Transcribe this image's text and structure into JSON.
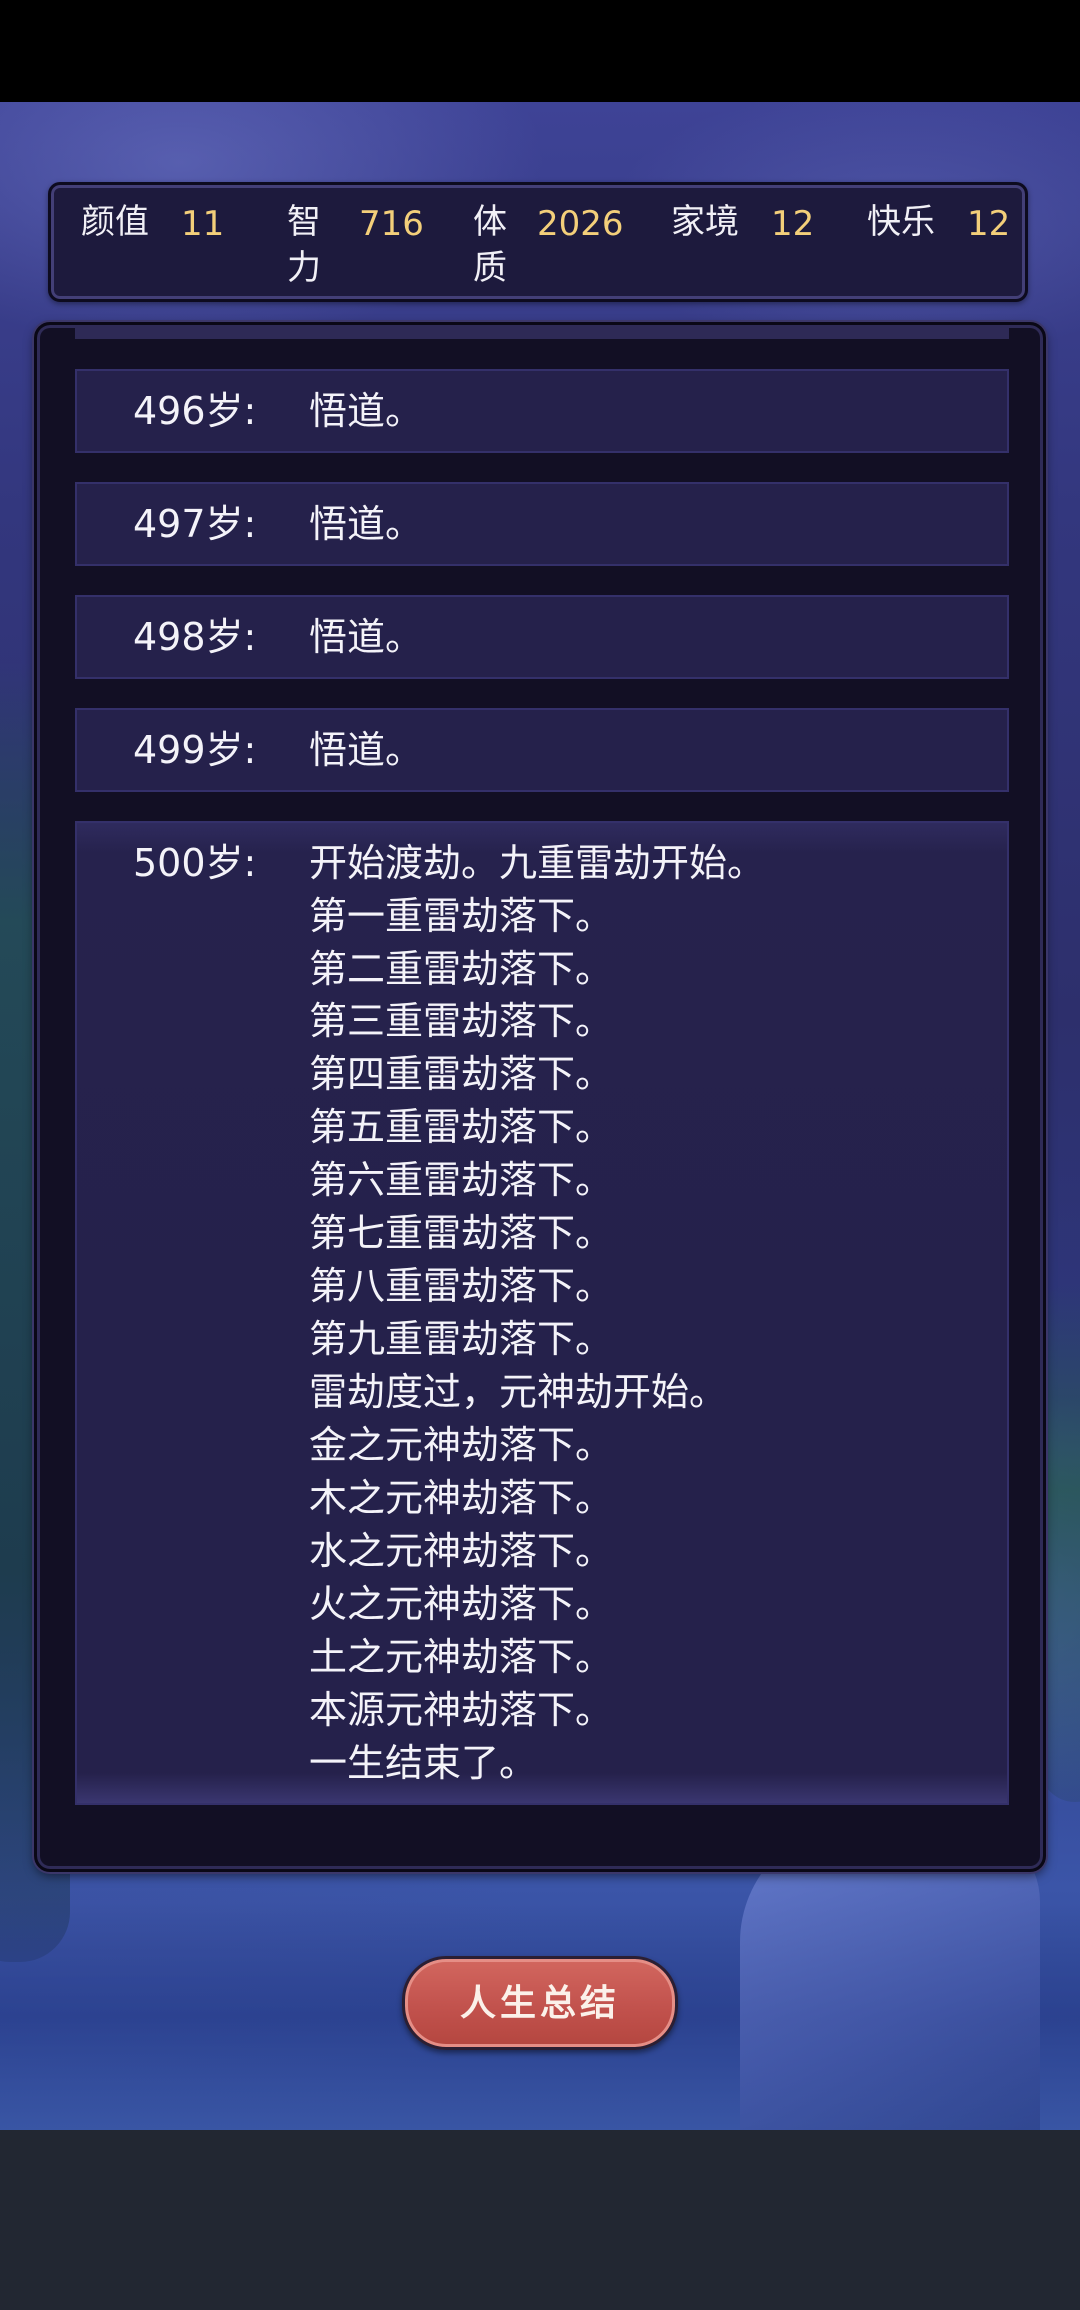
{
  "stats": [
    {
      "label": "颜值",
      "value": "11"
    },
    {
      "label": "智力",
      "value": "716"
    },
    {
      "label": "体质",
      "value": "2026"
    },
    {
      "label": "家境",
      "value": "12"
    },
    {
      "label": "快乐",
      "value": "12"
    }
  ],
  "log": [
    {
      "age": "496岁:",
      "text": "悟道。"
    },
    {
      "age": "497岁:",
      "text": "悟道。"
    },
    {
      "age": "498岁:",
      "text": "悟道。"
    },
    {
      "age": "499岁:",
      "text": "悟道。"
    },
    {
      "age": "500岁:",
      "lines": [
        "开始渡劫。九重雷劫开始。",
        "第一重雷劫落下。",
        "第二重雷劫落下。",
        "第三重雷劫落下。",
        "第四重雷劫落下。",
        "第五重雷劫落下。",
        "第六重雷劫落下。",
        "第七重雷劫落下。",
        "第八重雷劫落下。",
        "第九重雷劫落下。",
        "雷劫度过，元神劫开始。",
        "金之元神劫落下。",
        "木之元神劫落下。",
        "水之元神劫落下。",
        "火之元神劫落下。",
        "土之元神劫落下。",
        "本源元神劫落下。",
        "一生结束了。"
      ]
    }
  ],
  "summary_button": "人生总结",
  "colors": {
    "stat_value": "#f3cf7a",
    "button": "#c2524d",
    "panel": "#120f24",
    "entry": "#25214b"
  }
}
